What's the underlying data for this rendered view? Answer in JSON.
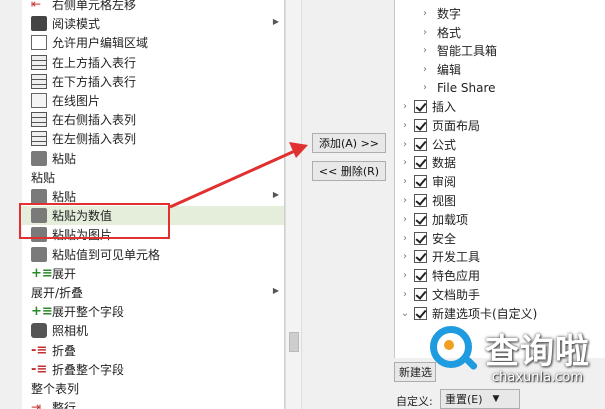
{
  "left_list": {
    "items": [
      {
        "label": "右侧单元格左移",
        "icon": "shift-left-icon",
        "arrow": false,
        "header": false
      },
      {
        "label": "阅读模式",
        "icon": "reading-mode-icon",
        "arrow": true,
        "header": false
      },
      {
        "label": "允许用户编辑区域",
        "icon": "edit-range-icon",
        "arrow": false,
        "header": false
      },
      {
        "label": "在上方插入表行",
        "icon": "insert-row-above-icon",
        "arrow": false,
        "header": false
      },
      {
        "label": "在下方插入表行",
        "icon": "insert-row-below-icon",
        "arrow": false,
        "header": false
      },
      {
        "label": "在线图片",
        "icon": "online-picture-icon",
        "arrow": false,
        "header": false
      },
      {
        "label": "在右侧插入表列",
        "icon": "insert-col-right-icon",
        "arrow": false,
        "header": false
      },
      {
        "label": "在左侧插入表列",
        "icon": "insert-col-left-icon",
        "arrow": false,
        "header": false
      },
      {
        "label": "粘贴",
        "icon": "paste-icon",
        "arrow": false,
        "header": false
      },
      {
        "label": "粘贴",
        "icon": "",
        "arrow": false,
        "header": true
      },
      {
        "label": "粘贴",
        "icon": "paste-icon",
        "arrow": true,
        "header": false
      },
      {
        "label": "粘贴为数值",
        "icon": "paste-values-icon",
        "arrow": false,
        "header": false
      },
      {
        "label": "粘贴为图片",
        "icon": "paste-picture-icon",
        "arrow": false,
        "header": false
      },
      {
        "label": "粘贴值到可见单元格",
        "icon": "paste-visible-icon",
        "arrow": false,
        "header": false
      },
      {
        "label": "展开",
        "icon": "expand-icon",
        "arrow": false,
        "header": false
      },
      {
        "label": "展开/折叠",
        "icon": "",
        "arrow": true,
        "header": true
      },
      {
        "label": "展开整个字段",
        "icon": "expand-field-icon",
        "arrow": false,
        "header": false
      },
      {
        "label": "照相机",
        "icon": "camera-icon",
        "arrow": false,
        "header": false
      },
      {
        "label": "折叠",
        "icon": "collapse-icon",
        "arrow": false,
        "header": false
      },
      {
        "label": "折叠整个字段",
        "icon": "collapse-field-icon",
        "arrow": false,
        "header": false
      },
      {
        "label": "整个表列",
        "icon": "",
        "arrow": false,
        "header": true
      },
      {
        "label": "整行",
        "icon": "entire-row-icon",
        "arrow": false,
        "header": false
      }
    ],
    "selected_index": 11
  },
  "buttons": {
    "add": "添加(A) >>",
    "remove": "<< 删除(R)"
  },
  "right_tree": {
    "sub_items": [
      "数字",
      "格式",
      "智能工具箱",
      "编辑",
      "File Share"
    ],
    "tabs": [
      "插入",
      "页面布局",
      "公式",
      "数据",
      "审阅",
      "视图",
      "加载项",
      "安全",
      "开发工具",
      "特色应用",
      "文档助手",
      "新建选项卡(自定义)"
    ]
  },
  "bottom": {
    "new_tab_btn": "新建选",
    "customize_label": "自定义:",
    "reset_btn": "重置(E)",
    "reset_arrow": "▼"
  },
  "watermark": {
    "brand": "查询啦",
    "domain": "chaxunla.com"
  },
  "colors": {
    "annotation_red": "#e03030",
    "selected_bg": "#e4eedb",
    "watermark_blue": "#1f9be0"
  }
}
